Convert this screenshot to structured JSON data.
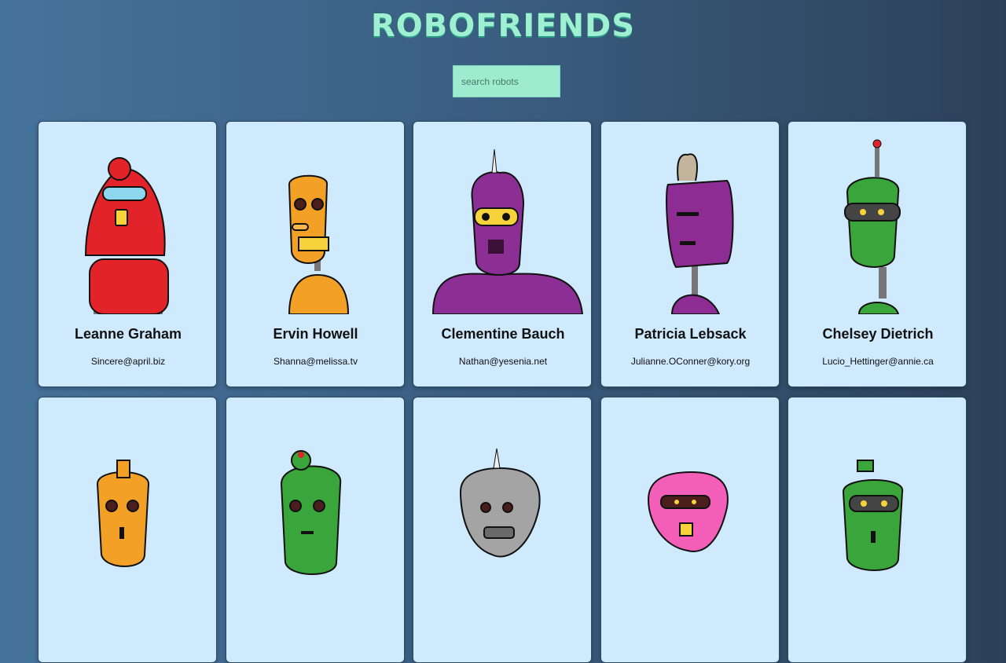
{
  "app": {
    "title": "ROBOFRIENDS",
    "search": {
      "placeholder": "search robots",
      "value": ""
    }
  },
  "robots": [
    {
      "name": "Leanne Graham",
      "email": "Sincere@april.biz",
      "color": "#e2232a",
      "icon": "red-robot-icon"
    },
    {
      "name": "Ervin Howell",
      "email": "Shanna@melissa.tv",
      "color": "#f2a126",
      "icon": "orange-robot-icon"
    },
    {
      "name": "Clementine Bauch",
      "email": "Nathan@yesenia.net",
      "color": "#8c2f95",
      "icon": "purple-robot-icon"
    },
    {
      "name": "Patricia Lebsack",
      "email": "Julianne.OConner@kory.org",
      "color": "#8d2d93",
      "icon": "purple-robot-icon"
    },
    {
      "name": "Chelsey Dietrich",
      "email": "Lucio_Hettinger@annie.ca",
      "color": "#39a53b",
      "icon": "green-robot-icon"
    },
    {
      "name": "",
      "email": "",
      "color": "#f2a126",
      "icon": "orange-robot-icon"
    },
    {
      "name": "",
      "email": "",
      "color": "#39a53b",
      "icon": "green-robot-icon"
    },
    {
      "name": "",
      "email": "",
      "color": "#a4a4a4",
      "icon": "gray-robot-icon"
    },
    {
      "name": "",
      "email": "",
      "color": "#f35fb8",
      "icon": "pink-robot-icon"
    },
    {
      "name": "",
      "email": "",
      "color": "#39a53b",
      "icon": "green-robot-icon"
    }
  ]
}
